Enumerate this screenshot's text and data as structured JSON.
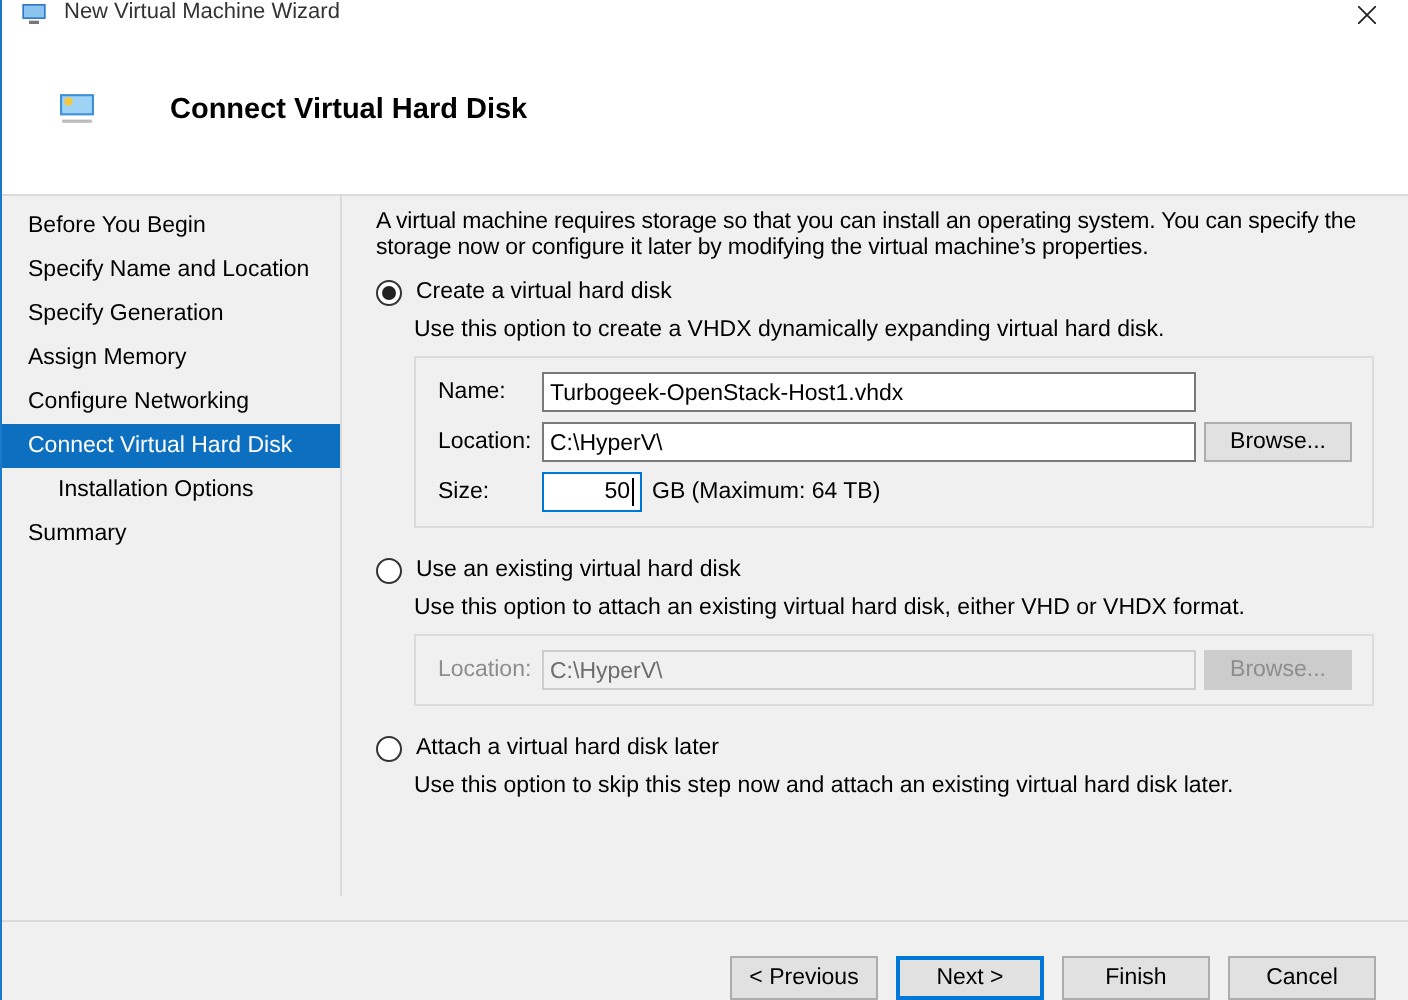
{
  "window": {
    "title": "New Virtual Machine Wizard"
  },
  "header": {
    "title": "Connect Virtual Hard Disk"
  },
  "nav": [
    {
      "label": "Before You Begin",
      "selected": false
    },
    {
      "label": "Specify Name and Location",
      "selected": false
    },
    {
      "label": "Specify Generation",
      "selected": false
    },
    {
      "label": "Assign Memory",
      "selected": false
    },
    {
      "label": "Configure Networking",
      "selected": false
    },
    {
      "label": "Connect Virtual Hard Disk",
      "selected": true,
      "children": [
        {
          "label": "Installation Options",
          "selected": false
        }
      ]
    },
    {
      "label": "Summary",
      "selected": false
    }
  ],
  "intro": "A virtual machine requires storage so that you can install an operating system. You can specify the storage now or configure it later by modifying the virtual machine’s properties.",
  "options": [
    {
      "label": "Create a virtual hard disk",
      "selected": true,
      "description": "Use this option to create a VHDX dynamically expanding virtual hard disk.",
      "disabled": false,
      "fields": [
        {
          "kind": "text",
          "label": "Name:",
          "value": "Turbogeek-OpenStack-Host1.vhdx"
        },
        {
          "kind": "path",
          "label": "Location:",
          "value": "C:\\HyperV\\",
          "button": "Browse..."
        },
        {
          "kind": "size",
          "label": "Size:",
          "value": "50",
          "unit": "GB (Maximum: 64 TB)",
          "focused": true
        }
      ]
    },
    {
      "label": "Use an existing virtual hard disk",
      "selected": false,
      "description": "Use this option to attach an existing virtual hard disk, either VHD or VHDX format.",
      "disabled": true,
      "fields": [
        {
          "kind": "path",
          "label": "Location:",
          "value": "C:\\HyperV\\",
          "button": "Browse..."
        }
      ]
    },
    {
      "label": "Attach a virtual hard disk later",
      "selected": false,
      "description": "Use this option to skip this step now and attach an existing virtual hard disk later."
    }
  ],
  "buttons": [
    {
      "label": "< Previous",
      "default": false
    },
    {
      "label": "Next >",
      "default": true
    },
    {
      "label": "Finish",
      "default": false
    },
    {
      "label": "Cancel",
      "default": false
    }
  ]
}
